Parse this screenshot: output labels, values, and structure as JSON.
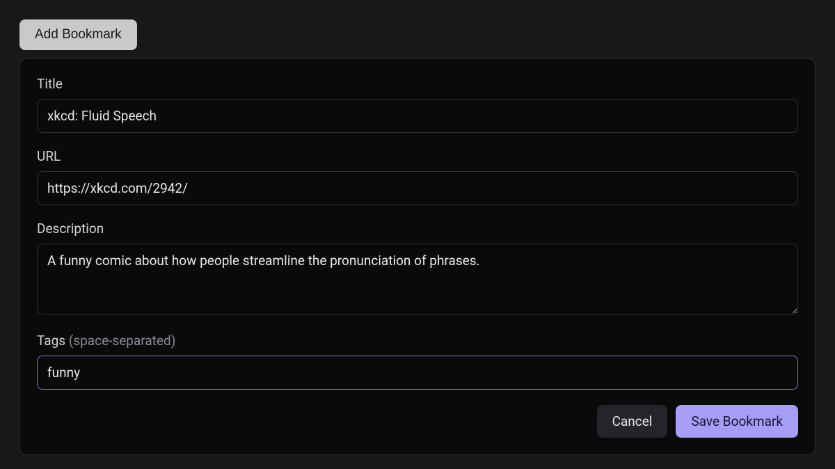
{
  "header": {
    "add_bookmark_label": "Add Bookmark"
  },
  "form": {
    "title": {
      "label": "Title",
      "value": "xkcd: Fluid Speech"
    },
    "url": {
      "label": "URL",
      "value": "https://xkcd.com/2942/"
    },
    "description": {
      "label": "Description",
      "value": "A funny comic about how people streamline the pronunciation of phrases."
    },
    "tags": {
      "label": "Tags ",
      "hint": "(space-separated)",
      "value": "funny "
    },
    "buttons": {
      "cancel": "Cancel",
      "save": "Save Bookmark"
    }
  }
}
